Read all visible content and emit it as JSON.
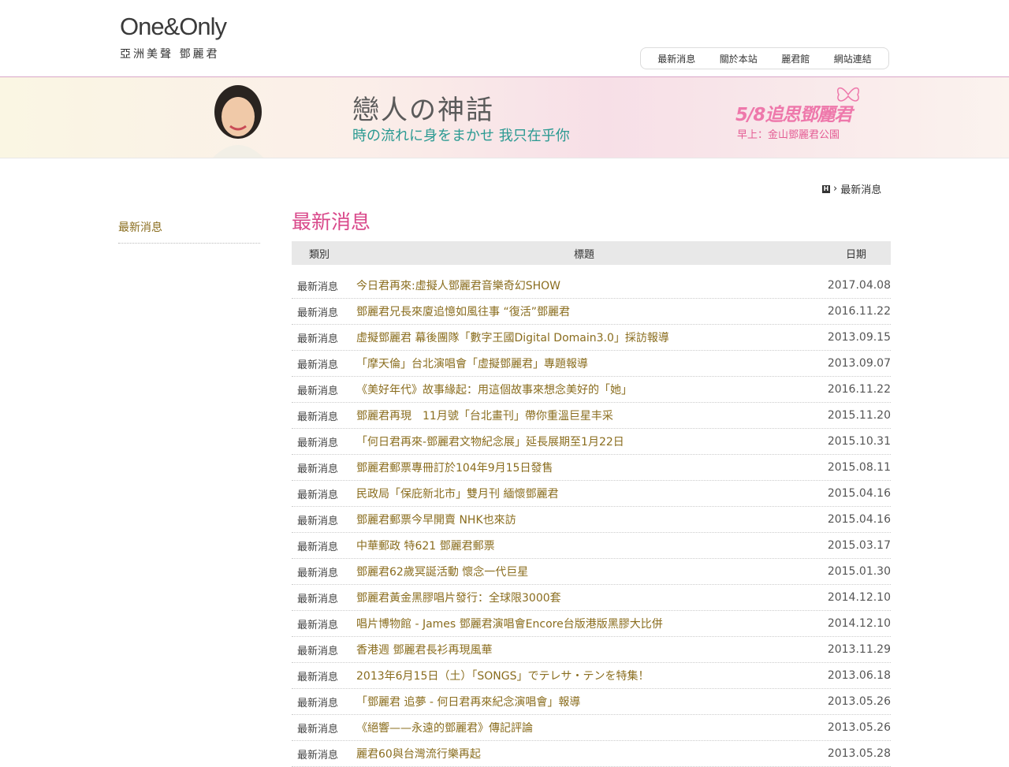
{
  "header": {
    "logo_text": "One&Only",
    "logo_sub": "亞洲美聲 鄧麗君",
    "nav": [
      "最新消息",
      "關於本站",
      "麗君館",
      "網站連結"
    ]
  },
  "banner": {
    "title": "戀人の神話",
    "subtitle": "時の流れに身をまかせ 我只在乎你",
    "memorial": "5/8追思鄧麗君",
    "memorial_sub": "早上：金山鄧麗君公園"
  },
  "breadcrumb": {
    "current": "最新消息"
  },
  "sidebar": {
    "items": [
      "最新消息"
    ]
  },
  "main": {
    "title": "最新消息",
    "headers": {
      "category": "類別",
      "title": "標題",
      "date": "日期"
    },
    "rows": [
      {
        "category": "最新消息",
        "title": "今日君再來:虛擬人鄧麗君音樂奇幻SHOW",
        "date": "2017.04.08"
      },
      {
        "category": "最新消息",
        "title": "鄧麗君兄長來廈追憶如風往事 “復活”鄧麗君",
        "date": "2016.11.22"
      },
      {
        "category": "最新消息",
        "title": "虛擬鄧麗君 幕後團隊「數字王國Digital Domain3.0」採訪報導",
        "date": "2013.09.15"
      },
      {
        "category": "最新消息",
        "title": "「摩天倫」台北演唱會「虛擬鄧麗君」專題報導",
        "date": "2013.09.07"
      },
      {
        "category": "最新消息",
        "title": "《美好年代》故事緣起：用這個故事來想念美好的「她」",
        "date": "2016.11.22"
      },
      {
        "category": "最新消息",
        "title": "鄧麗君再現　11月號「台北畫刊」帶你重溫巨星丰采",
        "date": "2015.11.20"
      },
      {
        "category": "最新消息",
        "title": "「何日君再來-鄧麗君文物紀念展」延長展期至1月22日",
        "date": "2015.10.31"
      },
      {
        "category": "最新消息",
        "title": "鄧麗君郵票專冊訂於104年9月15日發售",
        "date": "2015.08.11"
      },
      {
        "category": "最新消息",
        "title": "民政局「保庇新北市」雙月刊 緬懷鄧麗君",
        "date": "2015.04.16"
      },
      {
        "category": "最新消息",
        "title": "鄧麗君郵票今早開賣 NHK也來訪",
        "date": "2015.04.16"
      },
      {
        "category": "最新消息",
        "title": "中華郵政 特621 鄧麗君郵票",
        "date": "2015.03.17"
      },
      {
        "category": "最新消息",
        "title": "鄧麗君62歲冥誕活動 懷念一代巨星",
        "date": "2015.01.30"
      },
      {
        "category": "最新消息",
        "title": "鄧麗君黃金黑膠唱片發行：全球限3000套",
        "date": "2014.12.10"
      },
      {
        "category": "最新消息",
        "title": "唱片博物館 - James 鄧麗君演唱會Encore台版港版黑膠大比併",
        "date": "2014.12.10"
      },
      {
        "category": "最新消息",
        "title": "香港週 鄧麗君長衫再現風華",
        "date": "2013.11.29"
      },
      {
        "category": "最新消息",
        "title": "2013年6月15日（土）「SONGS」でテレサ・テンを特集！",
        "date": "2013.06.18"
      },
      {
        "category": "最新消息",
        "title": "「鄧麗君 追夢 - 何日君再來紀念演唱會」報導",
        "date": "2013.05.26"
      },
      {
        "category": "最新消息",
        "title": "《絕響——永遠的鄧麗君》傳記評論",
        "date": "2013.05.26"
      },
      {
        "category": "最新消息",
        "title": "麗君60與台灣流行樂再起",
        "date": "2013.05.28"
      }
    ]
  }
}
